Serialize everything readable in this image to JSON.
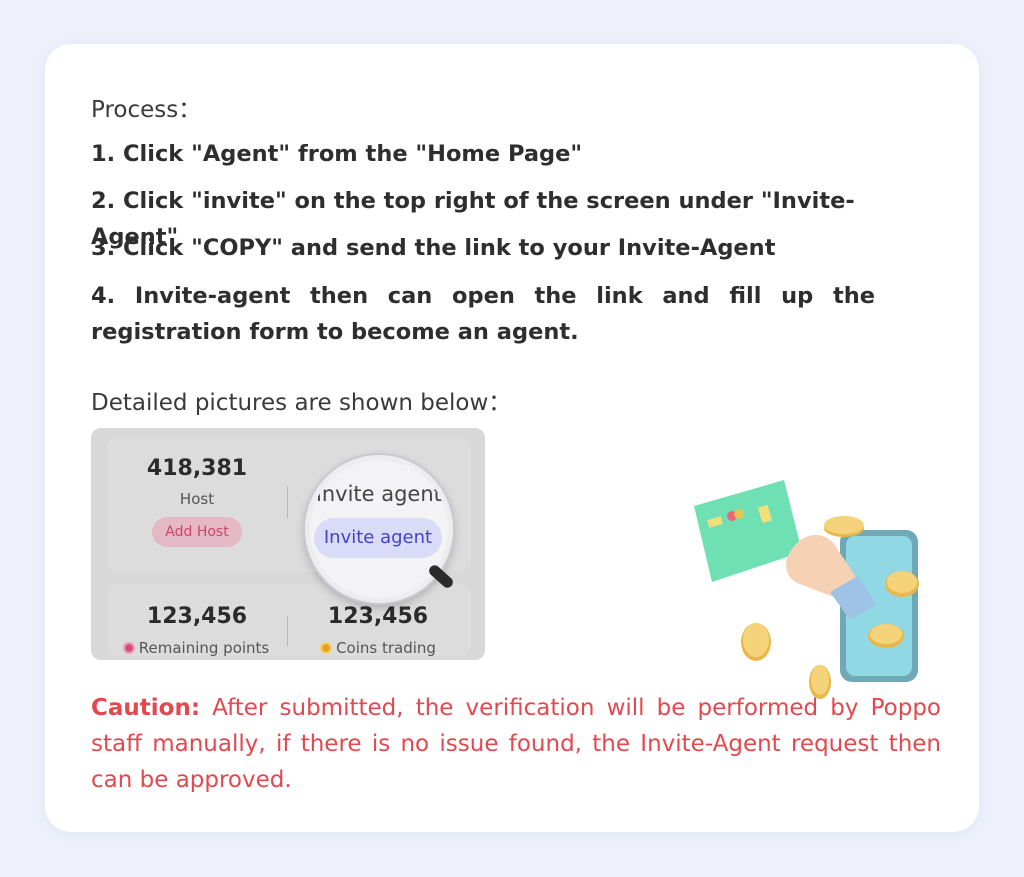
{
  "process": {
    "label": "Process：",
    "steps": [
      "1.  Click \"Agent\" from the \"Home Page\"",
      "2. Click \"invite\" on the top right of the screen under \"Invite-Agent\"",
      "3. Click \"COPY\" and send the link to your Invite-Agent",
      "4. Invite-agent then can open the link and fill up the registration form to become an agent."
    ]
  },
  "detail_label": "Detailed pictures are shown below：",
  "screenshot": {
    "host_count": "418,381",
    "host_label": "Host",
    "add_host_button": "Add Host",
    "remaining_points_value": "123,456",
    "remaining_points_label": "Remaining points",
    "coins_trading_value": "123,456",
    "coins_trading_label": "Coins trading",
    "magnifier_label": "invite agent",
    "invite_agent_button": "Invite agent"
  },
  "caution": {
    "label": "Caution:",
    "text": " After submitted, the verification will be performed by Poppo staff manually, if there is no issue found, the Invite-Agent request then can be approved."
  },
  "colors": {
    "background": "#eef1fb",
    "card": "#ffffff",
    "caution": "#e4484f",
    "invite_button_text": "#4343c8",
    "add_host_text": "#d0436c"
  }
}
